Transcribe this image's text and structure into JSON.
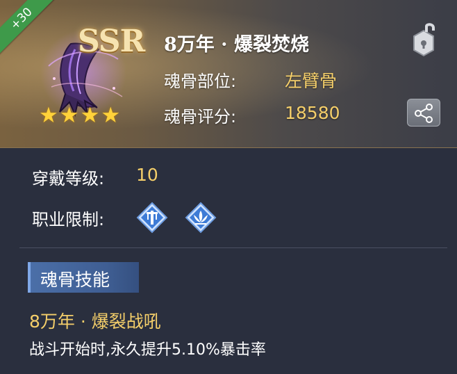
{
  "header": {
    "bonus_badge": "+30",
    "rarity": "SSR",
    "stars": "★★★★",
    "title": "8万年 · 爆裂焚烧",
    "position_label": "魂骨部位:",
    "position_value": "左臂骨",
    "score_label": "魂骨评分:",
    "score_value": "18580",
    "lock_icon": "unlock-icon",
    "share_icon": "share-icon"
  },
  "details": {
    "level_label": "穿戴等级:",
    "level_value": "10",
    "class_label": "职业限制:",
    "class_icons": [
      "weapon-class-icon",
      "lotus-class-icon"
    ]
  },
  "skill": {
    "section_label": "魂骨技能",
    "name": "8万年 · 爆裂战吼",
    "description": "战斗开始时,永久提升5.10%暴击率"
  },
  "colors": {
    "gold_text": "#f5cf6a",
    "badge_green": "#3e9a4a",
    "skill_tab_blue": "#4b6fa8",
    "star_yellow": "#ffd23a"
  }
}
